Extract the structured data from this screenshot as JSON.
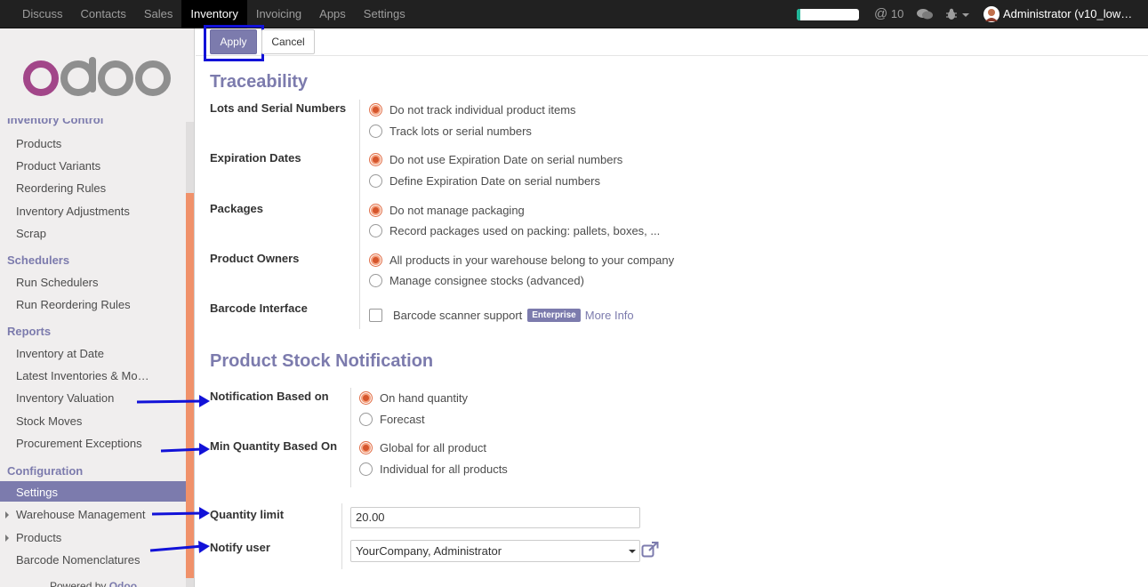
{
  "topbar": {
    "menu": [
      "Discuss",
      "Contacts",
      "Sales",
      "Inventory",
      "Invoicing",
      "Apps",
      "Settings"
    ],
    "active_index": 3,
    "progress_fraction": 0.06,
    "mentions_count": "10",
    "user": "Administrator (v10_low…"
  },
  "control_panel": {
    "apply_label": "Apply",
    "cancel_label": "Cancel"
  },
  "sidebar": {
    "logo_text": "odoo",
    "cut_header": "Inventory Control",
    "inventory_control": [
      "Products",
      "Product Variants",
      "Reordering Rules",
      "Inventory Adjustments",
      "Scrap"
    ],
    "schedulers_header": "Schedulers",
    "schedulers": [
      "Run Schedulers",
      "Run Reordering Rules"
    ],
    "reports_header": "Reports",
    "reports": [
      "Inventory at Date",
      "Latest Inventories & Mo…",
      "Inventory Valuation",
      "Stock Moves",
      "Procurement Exceptions"
    ],
    "configuration_header": "Configuration",
    "configuration": [
      "Settings",
      "Warehouse Management",
      "Products",
      "Barcode Nomenclatures"
    ],
    "powered_by": "Powered by",
    "powered_brand": "Odoo"
  },
  "traceability": {
    "title": "Traceability",
    "lots_label": "Lots and Serial Numbers",
    "lots_options": [
      "Do not track individual product items",
      "Track lots or serial numbers"
    ],
    "expiration_label": "Expiration Dates",
    "expiration_options": [
      "Do not use Expiration Date on serial numbers",
      "Define Expiration Date on serial numbers"
    ],
    "packages_label": "Packages",
    "packages_options": [
      "Do not manage packaging",
      "Record packages used on packing: pallets, boxes, ..."
    ],
    "owners_label": "Product Owners",
    "owners_options": [
      "All products in your warehouse belong to your company",
      "Manage consignee stocks (advanced)"
    ],
    "barcode_label": "Barcode Interface",
    "barcode_text": "Barcode scanner support",
    "barcode_badge": "Enterprise",
    "barcode_more": "More Info"
  },
  "stock_notification": {
    "title": "Product Stock Notification",
    "based_on_label": "Notification Based on",
    "based_on_options": [
      "On hand quantity",
      "Forecast"
    ],
    "min_qty_label": "Min Quantity Based On",
    "min_qty_options": [
      "Global for all product",
      "Individual for all products"
    ],
    "qty_limit_label": "Quantity limit",
    "qty_limit_value": "20.00",
    "notify_user_label": "Notify user",
    "notify_user_value": "YourCompany, Administrator"
  },
  "colors": {
    "accent": "#7c7bad",
    "topbar": "#212121",
    "radio_selected": "#d5552c",
    "annotation": "#1212d8",
    "scroll_thumb": "#f0916a"
  }
}
